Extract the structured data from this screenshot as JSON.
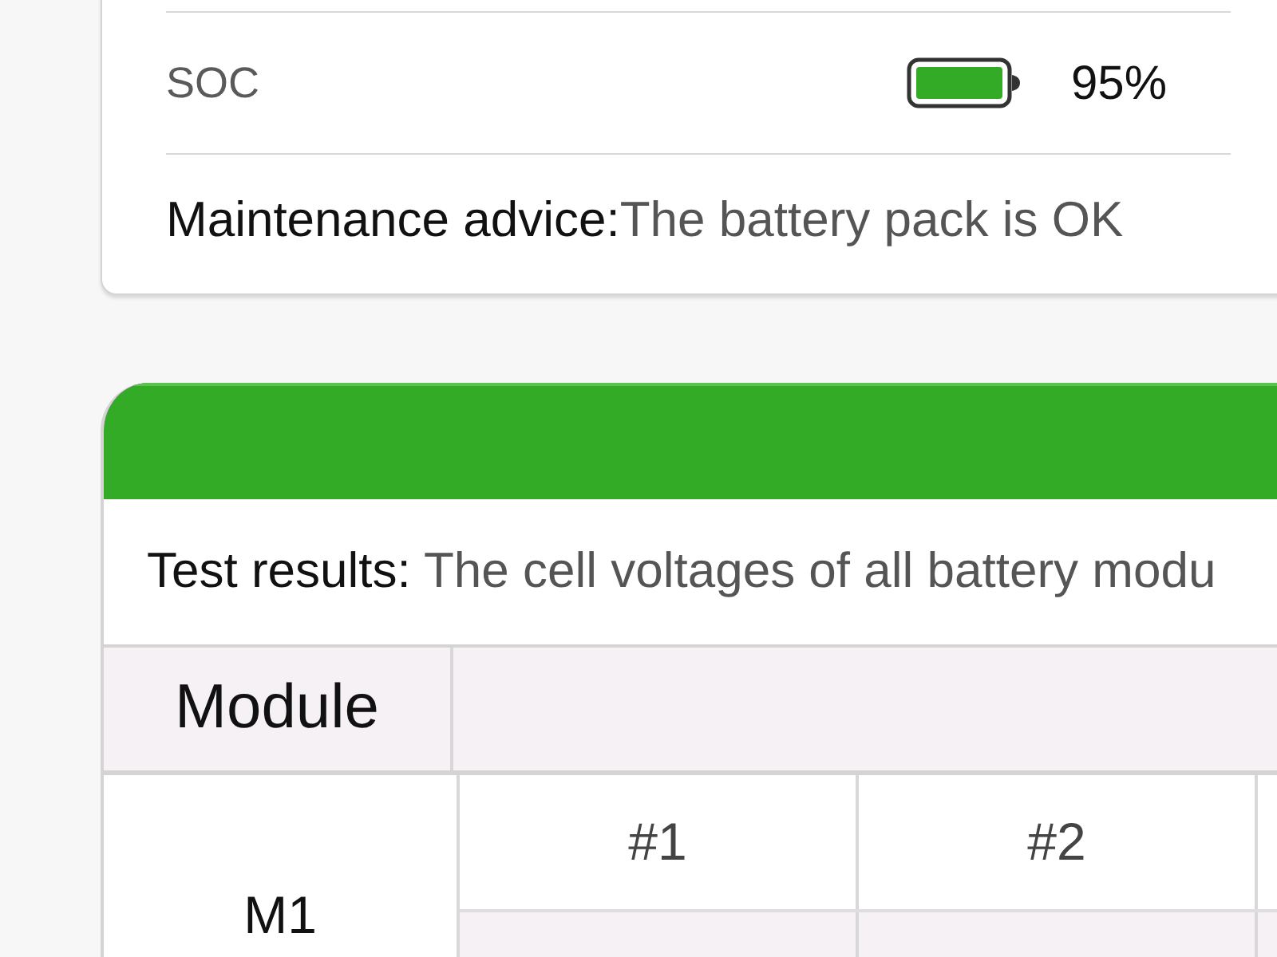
{
  "battery_card": {
    "soc": {
      "label": "SOC",
      "value": "95%"
    },
    "advice": {
      "label": "Maintenance advice:",
      "value": "The battery pack is OK"
    }
  },
  "module_card": {
    "test_results": {
      "label": "Test results:",
      "value": "The cell voltages of all battery modu"
    },
    "table": {
      "header": [
        "Module"
      ],
      "rows": [
        {
          "module": "M1",
          "cells": [
            "#1",
            "#2"
          ]
        }
      ]
    }
  }
}
